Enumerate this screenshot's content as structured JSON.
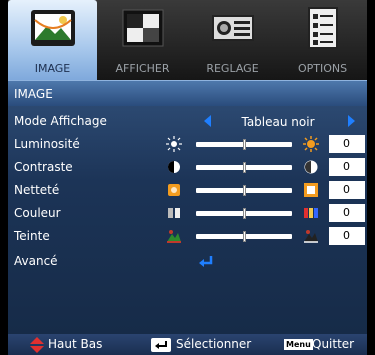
{
  "tabs": [
    {
      "label": "IMAGE",
      "icon": "image-icon",
      "active": true
    },
    {
      "label": "AFFICHER",
      "icon": "display-icon",
      "active": false
    },
    {
      "label": "REGLAGE",
      "icon": "projector-icon",
      "active": false
    },
    {
      "label": "OPTIONS",
      "icon": "options-list-icon",
      "active": false
    }
  ],
  "panel": {
    "title": "IMAGE",
    "mode": {
      "label": "Mode Affichage",
      "value": "Tableau noir"
    },
    "sliders": [
      {
        "label": "Luminosité",
        "value": "0",
        "level": 0.5,
        "icon_left": "dim-sun-icon",
        "icon_right": "bright-sun-icon"
      },
      {
        "label": "Contraste",
        "value": "0",
        "level": 0.5,
        "icon_left": "contrast-low-icon",
        "icon_right": "contrast-high-icon"
      },
      {
        "label": "Netteté",
        "value": "0",
        "level": 0.5,
        "icon_left": "sharpness-low-icon",
        "icon_right": "sharpness-high-icon"
      },
      {
        "label": "Couleur",
        "value": "0",
        "level": 0.5,
        "icon_left": "color-low-icon",
        "icon_right": "color-high-icon"
      },
      {
        "label": "Teinte",
        "value": "0",
        "level": 0.5,
        "icon_left": "tint-low-icon",
        "icon_right": "tint-high-icon"
      }
    ],
    "advanced": {
      "label": "Avancé",
      "icon": "enter-arrow-icon"
    }
  },
  "footer": {
    "nav": "Haut Bas",
    "select": "Sélectionner",
    "menu_key": "Menu",
    "quit": "Quitter"
  },
  "colors": {
    "accent": "#1f7fff",
    "orange": "#f39c1f",
    "panel": "#1c3457"
  }
}
